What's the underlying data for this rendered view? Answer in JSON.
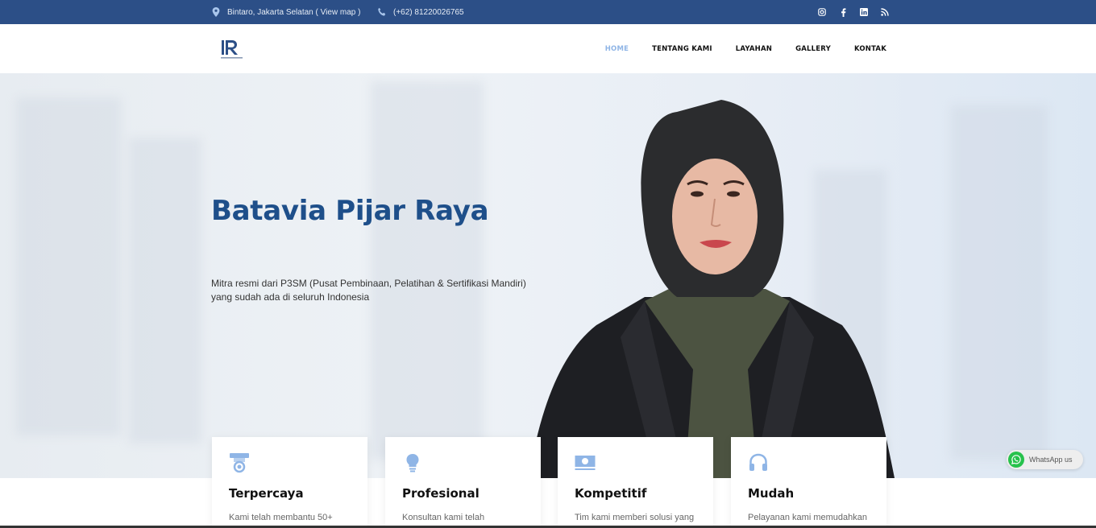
{
  "topbar": {
    "location": "Bintaro, Jakarta Selatan ( View map )",
    "phone": "(+62) 81220026765",
    "location_icon": "map-pin-icon",
    "phone_icon": "phone-icon",
    "social_icons": [
      "instagram-icon",
      "facebook-icon",
      "linkedin-icon",
      "rss-icon"
    ]
  },
  "navbar": {
    "logo_icon": "company-logo",
    "menu": [
      {
        "label": "HOME",
        "active": true
      },
      {
        "label": "TENTANG KAMI",
        "active": false
      },
      {
        "label": "LAYAHAN",
        "active": false
      },
      {
        "label": "GALLERY",
        "active": false
      },
      {
        "label": "KONTAK",
        "active": false
      }
    ]
  },
  "hero": {
    "title": "Batavia Pijar Raya",
    "subtitle_line1": "Mitra resmi dari P3SM (Pusat Pembinaan, Pelatihan & Sertifikasi Mandiri)",
    "subtitle_line2": "yang sudah ada di seluruh Indonesia"
  },
  "features": [
    {
      "title": "Terpercaya",
      "text": "Kami telah membantu 50+",
      "icon": "badge-medal-icon"
    },
    {
      "title": "Profesional",
      "text": "Konsultan kami telah",
      "icon": "lightbulb-icon"
    },
    {
      "title": "Kompetitif",
      "text": "Tim kami memberi solusi yang",
      "icon": "money-icon"
    },
    {
      "title": "Mudah",
      "text": "Pelayanan kami memudahkan",
      "icon": "headset-icon"
    }
  ],
  "whatsapp": {
    "label": "WhatsApp us",
    "icon": "whatsapp-icon"
  },
  "colors": {
    "topbar": "#2c4f87",
    "accent": "#1e4f8a",
    "nav_active": "#8fb5e6",
    "icon": "#8fb5e6",
    "whatsapp": "#27c24c"
  }
}
